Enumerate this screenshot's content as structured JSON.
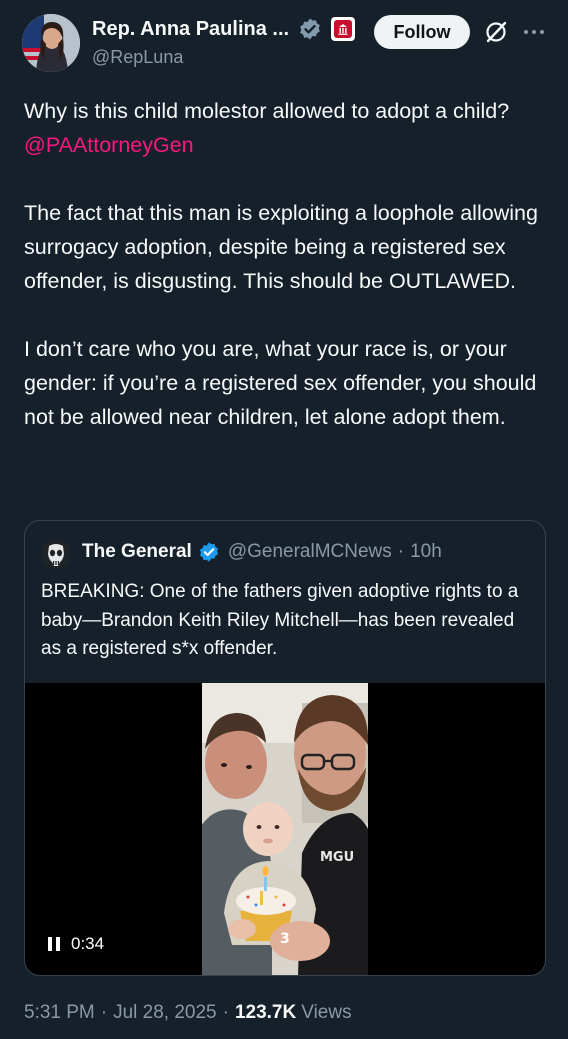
{
  "author": {
    "display_name": "Rep. Anna Paulina ...",
    "handle": "@RepLuna",
    "avatar_icon": "profile-photo"
  },
  "actions": {
    "follow_label": "Follow",
    "grok_icon": "grok-icon",
    "more_icon": "more-horizontal-icon"
  },
  "tweet": {
    "line1_text": "Why is this child molestor allowed to adopt a child? ",
    "line1_mention": "@PAAttorneyGen",
    "para2": "The fact that this man is exploiting a loophole allowing surrogacy adoption, despite being a registered sex offender, is disgusting. This should be OUTLAWED.",
    "para3": "I don’t care who you are, what your race is, or your gender: if you’re a registered sex offender, you should not be allowed near children, let alone adopt them."
  },
  "quote": {
    "name": "The General",
    "handle": "@GeneralMCNews",
    "dot": "·",
    "time": "10h",
    "text": "BREAKING: One of the fathers given adoptive rights to a baby—Brandon Keith Riley Mitchell—has been revealed as a registered s*x offender.",
    "video": {
      "duration": "0:34",
      "state": "playing",
      "cupcake_number": "3",
      "shirt_text": "MGU"
    }
  },
  "meta": {
    "time": "5:31 PM",
    "sep1": "·",
    "date": "Jul 28, 2025",
    "sep2": "·",
    "views_count": "123.7K",
    "views_label": "Views"
  },
  "colors": {
    "background": "#15202b",
    "mention": "#f91880",
    "verified": "#1d9bf0",
    "secondary_text": "#8b98a5"
  }
}
